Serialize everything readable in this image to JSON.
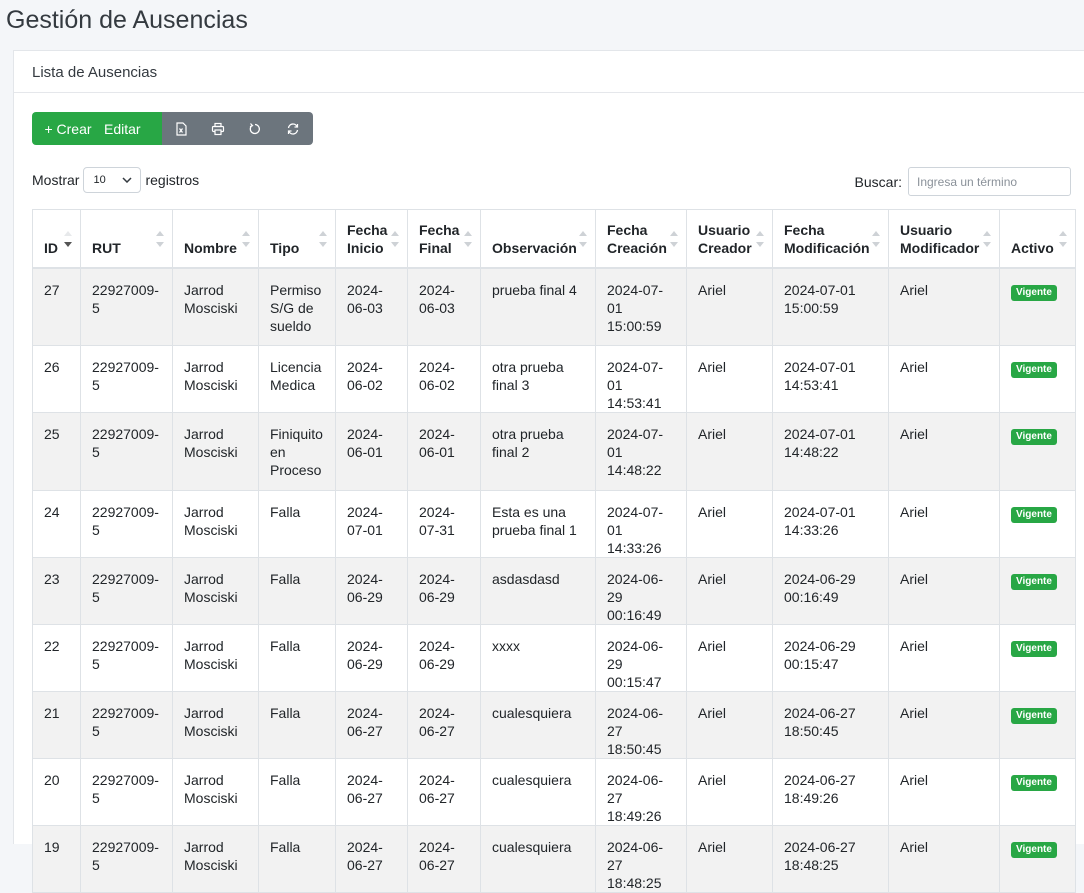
{
  "page": {
    "title": "Gestión de Ausencias"
  },
  "card": {
    "header": "Lista de Ausencias"
  },
  "toolbar": {
    "create_label": "+ Crear",
    "edit_label": "Editar",
    "icons": [
      "excel-icon",
      "print-icon",
      "undo-icon",
      "refresh-icon"
    ]
  },
  "length": {
    "prefix": "Mostrar",
    "value": "10",
    "suffix": "registros"
  },
  "search": {
    "label": "Buscar:",
    "placeholder": "Ingresa un término"
  },
  "table": {
    "columns": [
      "ID",
      "RUT",
      "Nombre",
      "Tipo",
      "Fecha Inicio",
      "Fecha Final",
      "Observación",
      "Fecha Creación",
      "Usuario Creador",
      "Fecha Modificación",
      "Usuario Modificador",
      "Activo"
    ],
    "rows": [
      {
        "id": "27",
        "rut": "22927009-5",
        "nombre": "Jarrod Mosciski",
        "tipo": "Permiso S/G de sueldo",
        "inicio": "2024-06-03",
        "final": "2024-06-03",
        "obs": "prueba final 4",
        "creacion": "2024-07-01 15:00:59",
        "creador": "Ariel",
        "modificacion": "2024-07-01 15:00:59",
        "modificador": "Ariel",
        "activo": "Vigente"
      },
      {
        "id": "26",
        "rut": "22927009-5",
        "nombre": "Jarrod Mosciski",
        "tipo": "Licencia Medica",
        "inicio": "2024-06-02",
        "final": "2024-06-02",
        "obs": "otra prueba final 3",
        "creacion": "2024-07-01 14:53:41",
        "creador": "Ariel",
        "modificacion": "2024-07-01 14:53:41",
        "modificador": "Ariel",
        "activo": "Vigente"
      },
      {
        "id": "25",
        "rut": "22927009-5",
        "nombre": "Jarrod Mosciski",
        "tipo": "Finiquito en Proceso",
        "inicio": "2024-06-01",
        "final": "2024-06-01",
        "obs": "otra prueba final 2",
        "creacion": "2024-07-01 14:48:22",
        "creador": "Ariel",
        "modificacion": "2024-07-01 14:48:22",
        "modificador": "Ariel",
        "activo": "Vigente"
      },
      {
        "id": "24",
        "rut": "22927009-5",
        "nombre": "Jarrod Mosciski",
        "tipo": "Falla",
        "inicio": "2024-07-01",
        "final": "2024-07-31",
        "obs": "Esta es una prueba final 1",
        "creacion": "2024-07-01 14:33:26",
        "creador": "Ariel",
        "modificacion": "2024-07-01 14:33:26",
        "modificador": "Ariel",
        "activo": "Vigente"
      },
      {
        "id": "23",
        "rut": "22927009-5",
        "nombre": "Jarrod Mosciski",
        "tipo": "Falla",
        "inicio": "2024-06-29",
        "final": "2024-06-29",
        "obs": "asdasdasd",
        "creacion": "2024-06-29 00:16:49",
        "creador": "Ariel",
        "modificacion": "2024-06-29 00:16:49",
        "modificador": "Ariel",
        "activo": "Vigente"
      },
      {
        "id": "22",
        "rut": "22927009-5",
        "nombre": "Jarrod Mosciski",
        "tipo": "Falla",
        "inicio": "2024-06-29",
        "final": "2024-06-29",
        "obs": "xxxx",
        "creacion": "2024-06-29 00:15:47",
        "creador": "Ariel",
        "modificacion": "2024-06-29 00:15:47",
        "modificador": "Ariel",
        "activo": "Vigente"
      },
      {
        "id": "21",
        "rut": "22927009-5",
        "nombre": "Jarrod Mosciski",
        "tipo": "Falla",
        "inicio": "2024-06-27",
        "final": "2024-06-27",
        "obs": "cualesquiera",
        "creacion": "2024-06-27 18:50:45",
        "creador": "Ariel",
        "modificacion": "2024-06-27 18:50:45",
        "modificador": "Ariel",
        "activo": "Vigente"
      },
      {
        "id": "20",
        "rut": "22927009-5",
        "nombre": "Jarrod Mosciski",
        "tipo": "Falla",
        "inicio": "2024-06-27",
        "final": "2024-06-27",
        "obs": "cualesquiera",
        "creacion": "2024-06-27 18:49:26",
        "creador": "Ariel",
        "modificacion": "2024-06-27 18:49:26",
        "modificador": "Ariel",
        "activo": "Vigente"
      },
      {
        "id": "19",
        "rut": "22927009-5",
        "nombre": "Jarrod Mosciski",
        "tipo": "Falla",
        "inicio": "2024-06-27",
        "final": "2024-06-27",
        "obs": "cualesquiera",
        "creacion": "2024-06-27 18:48:25",
        "creador": "Ariel",
        "modificacion": "2024-06-27 18:48:25",
        "modificador": "Ariel",
        "activo": "Vigente"
      }
    ]
  },
  "colors": {
    "success": "#28a745",
    "secondary": "#6c757d",
    "stripe": "#f2f2f2"
  }
}
